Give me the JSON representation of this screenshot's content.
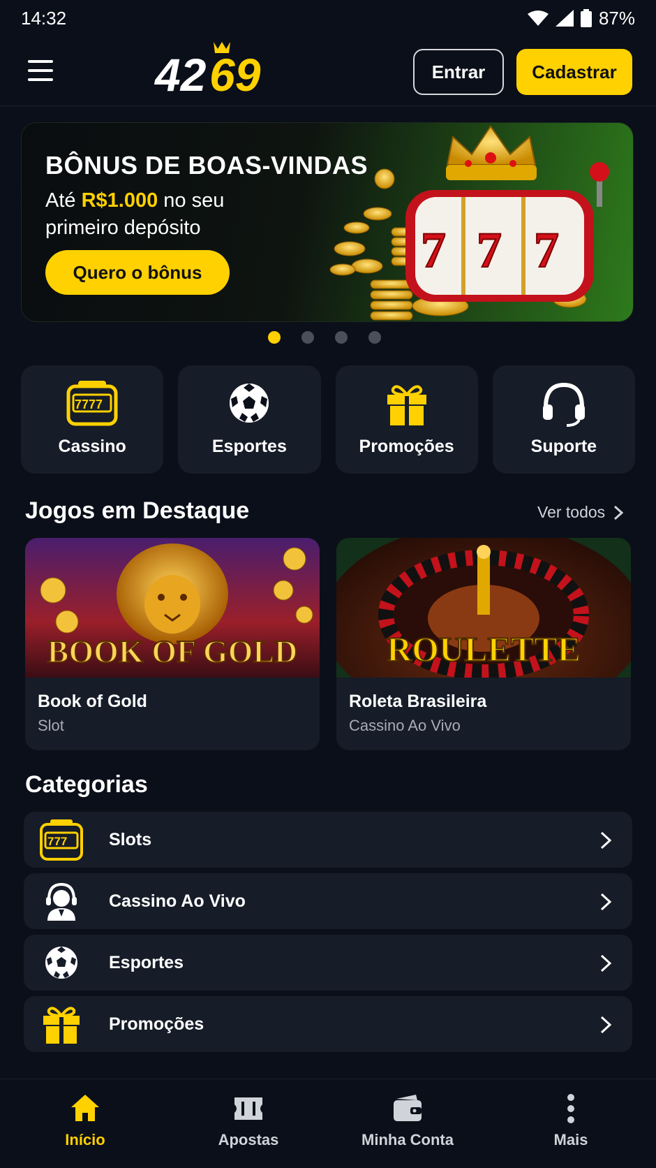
{
  "status_bar": {
    "time": "14:32",
    "battery": "87%"
  },
  "header": {
    "logo_text_white": "42",
    "logo_text_yellow": "69",
    "login_label": "Entrar",
    "signup_label": "Cadastrar"
  },
  "banner": {
    "title": "BÔNUS DE BOAS-VINDAS",
    "sub_prefix": "Até ",
    "sub_amount": "R$1.000",
    "sub_suffix": " no seu primeiro depósito",
    "cta": "Quero o bônus",
    "slot_digits": [
      "7",
      "7",
      "7"
    ],
    "carousel_count": 4,
    "carousel_active": 1
  },
  "quick_tiles": [
    {
      "label": "Cassino",
      "icon": "slot-machine-icon"
    },
    {
      "label": "Esportes",
      "icon": "soccer-ball-icon"
    },
    {
      "label": "Promoções",
      "icon": "gift-icon"
    },
    {
      "label": "Suporte",
      "icon": "headset-icon"
    }
  ],
  "featured": {
    "title": "Jogos em Destaque",
    "see_all": "Ver todos",
    "games": [
      {
        "name": "Book of Gold",
        "category": "Slot",
        "art_text": "BOOK OF GOLD"
      },
      {
        "name": "Roleta Brasileira",
        "category": "Cassino Ao Vivo",
        "art_text": "ROULETTE"
      }
    ]
  },
  "categories": {
    "title": "Categorias",
    "items": [
      {
        "label": "Slots",
        "icon": "slot-machine-icon"
      },
      {
        "label": "Cassino Ao Vivo",
        "icon": "live-dealer-icon"
      },
      {
        "label": "Esportes",
        "icon": "soccer-ball-icon"
      },
      {
        "label": "Promoções",
        "icon": "gift-icon"
      }
    ]
  },
  "bottom_nav": {
    "items": [
      {
        "label": "Início",
        "icon": "home-icon",
        "active": true
      },
      {
        "label": "Apostas",
        "icon": "ticket-icon",
        "active": false
      },
      {
        "label": "Minha Conta",
        "icon": "wallet-icon",
        "active": false
      },
      {
        "label": "Mais",
        "icon": "more-vertical-icon",
        "active": false
      }
    ]
  },
  "colors": {
    "accent": "#ffd100",
    "background": "#0b0f19",
    "card": "#161c28"
  }
}
